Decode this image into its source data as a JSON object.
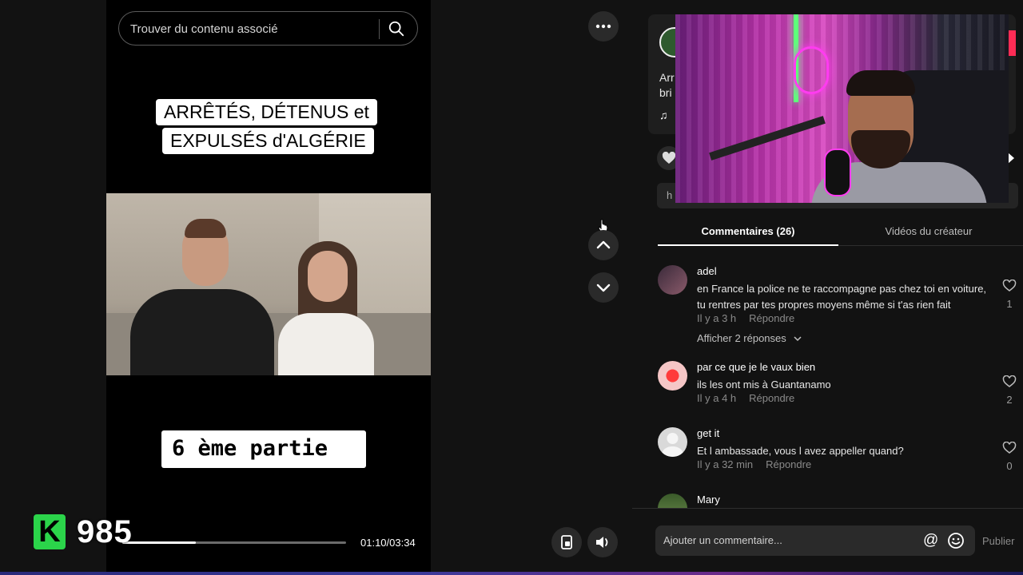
{
  "search": {
    "placeholder": "Trouver du contenu associé"
  },
  "video": {
    "title_line1": "ARRÊTÉS, DÉTENUS et",
    "title_line2": "EXPULSÉS d'ALGÉRIE",
    "part_label": "6 ème partie",
    "time": "01:10/03:34",
    "progress_fraction": 0.33,
    "overlay_counter": "985",
    "overlay_letter": "K"
  },
  "creator": {
    "desc_fragment_1": "Arr",
    "desc_fragment_2": "bri",
    "note_icon": "♫",
    "link_fragment": "h"
  },
  "tabs": {
    "comments": "Commentaires (26)",
    "creator_videos": "Vidéos du créateur"
  },
  "comments": [
    {
      "user": "adel",
      "text": "en France la police ne te raccompagne pas chez toi en voiture, tu rentres par tes propres moyens même si t'as rien fait",
      "time": "Il y a 3 h",
      "reply": "Répondre",
      "likes": "1",
      "show_replies": "Afficher 2 réponses"
    },
    {
      "user": "par ce que je le vaux bien",
      "text": "ils les ont mis à Guantanamo",
      "time": "Il y a 4 h",
      "reply": "Répondre",
      "likes": "2"
    },
    {
      "user": "get it",
      "text": "Et l ambassade, vous l avez appeller quand?",
      "time": "Il y a 32 min",
      "reply": "Répondre",
      "likes": "0"
    },
    {
      "user": "Mary"
    }
  ],
  "composer": {
    "placeholder": "Ajouter un commentaire...",
    "at_symbol": "@",
    "publish": "Publier"
  },
  "colors": {
    "accent_red": "#fe2c55",
    "badge_green": "#2bd44a",
    "background": "#121212"
  }
}
